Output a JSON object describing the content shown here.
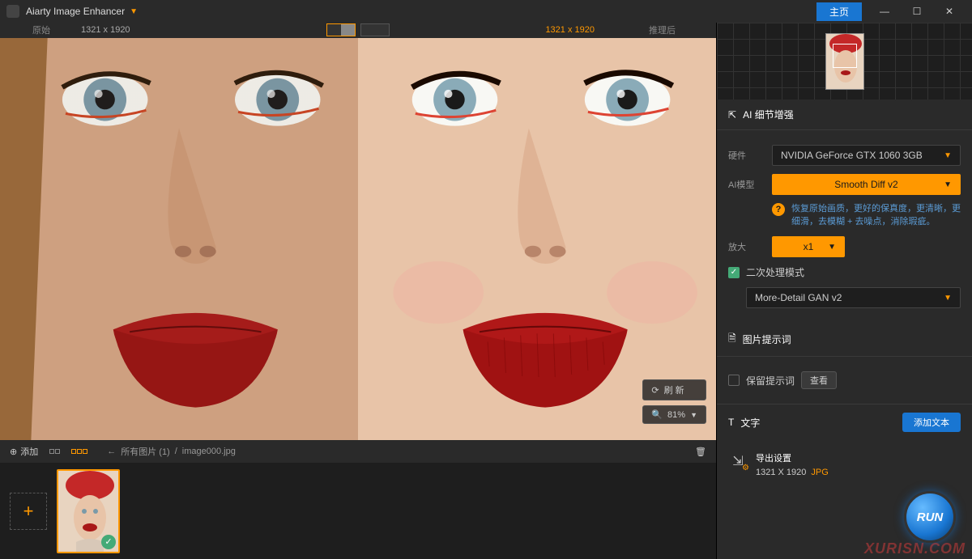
{
  "titlebar": {
    "app_name": "Aiarty Image Enhancer",
    "home_label": "主页"
  },
  "preview": {
    "label_original": "原始",
    "label_after": "推理后",
    "dim_left": "1321 x 1920",
    "dim_right": "1321 x 1920",
    "refresh_label": "刷 新",
    "zoom_label": "81%"
  },
  "panel": {
    "detail_header": "AI 细节增强",
    "hardware_label": "硬件",
    "hardware_value": "NVIDIA GeForce GTX 1060 3GB",
    "model_label": "AI模型",
    "model_value": "Smooth Diff v2",
    "model_hint": "恢复原始画质，更好的保真度，更清晰，更细滑，去模糊 + 去噪点，消除瑕疵。",
    "scale_label": "放大",
    "scale_value": "x1",
    "secondary_label": "二次处理模式",
    "secondary_model": "More-Detail GAN v2",
    "prompt_header": "图片提示词",
    "keep_prompt_label": "保留提示词",
    "view_btn": "查看",
    "text_header": "文字",
    "add_text_btn": "添加文本"
  },
  "thumbbar": {
    "add_label": "添加",
    "breadcrumb_all": "所有图片 (1)",
    "breadcrumb_file": "image000.jpg"
  },
  "export": {
    "header": "导出设置",
    "dimensions": "1321 X 1920",
    "format": "JPG",
    "run_label": "RUN"
  },
  "watermark": "XURISN.COM"
}
